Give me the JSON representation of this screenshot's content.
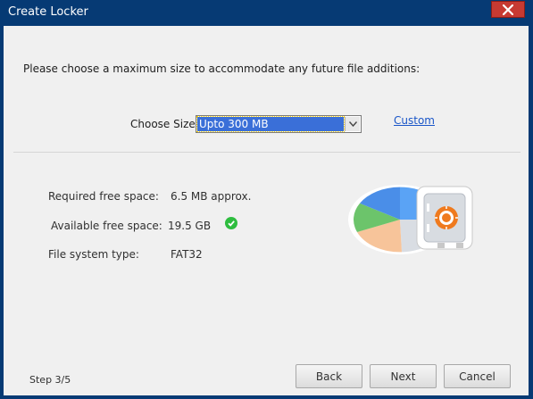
{
  "window": {
    "title": "Create Locker"
  },
  "page": {
    "prompt": "Please choose a maximum size to accommodate any future file additions:",
    "choose_size_label": "Choose Size:",
    "choose_size_value": "Upto 300 MB",
    "custom_link": "Custom"
  },
  "info": {
    "required_label": "Required free space:",
    "required_value": "6.5 MB approx.",
    "available_label": "Available free space:",
    "available_value": "19.5 GB",
    "filesystem_label": "File system type:",
    "filesystem_value": "FAT32"
  },
  "footer": {
    "step": "Step 3/5",
    "back_label": "Back",
    "next_label": "Next",
    "cancel_label": "Cancel"
  },
  "icons": {
    "close": "close-icon",
    "dropdown": "chevron-down-icon",
    "check": "check-icon",
    "illustration": "pie-chart-safe-icon"
  },
  "colors": {
    "titlebar": "#063a74",
    "close_button": "#c73a32",
    "selection": "#3a6fd8",
    "link": "#1a56c8",
    "check": "#2ebd3f"
  }
}
